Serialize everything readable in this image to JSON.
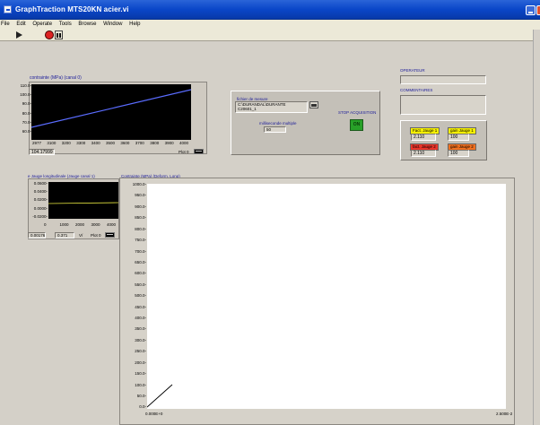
{
  "window": {
    "title": "GraphTraction MTS20KN acier.vi"
  },
  "menu": [
    "File",
    "Edit",
    "Operate",
    "Tools",
    "Browse",
    "Window",
    "Help"
  ],
  "top_chart": {
    "label": "contrainte (MPa) (canal 0)",
    "y_ticks": [
      "110.0-",
      "100.0-",
      "90.0-",
      "80.0-",
      "70.0-",
      "60.0-"
    ],
    "x_ticks": [
      "2977",
      "3100",
      "3200",
      "3300",
      "3400",
      "3500",
      "3600",
      "3700",
      "3800",
      "3900",
      "4000"
    ],
    "readout": "104.17999",
    "plot_label": "Plot 0",
    "trace_color": "#5a6cff"
  },
  "measure": {
    "file_label": "fichier de mesure",
    "file_path_1": "C:\\DURANDAL\\DURANTE",
    "file_path_2": "C20601_1",
    "ms_label": "milliseconde multiple",
    "ms_value": "50",
    "stop_label": "STOP ACQUISITION",
    "on_label": "ON"
  },
  "operator": {
    "label": "OPERATEUR",
    "comments_label": "COMMENTAIRES"
  },
  "gauges": {
    "g1_fact_label": "Fact. Jauge 1",
    "g1_fact_value": "2.110",
    "g1_gain_label": "gain Jauge 1",
    "g1_gain_value": "100",
    "g2_fact_label": "fact. Jauge 2",
    "g2_fact_value": "2.110",
    "g2_gain_label": "gain Jauge 2",
    "g2_gain_value": "100"
  },
  "small_chart": {
    "label": "e Jauge longitudinale (Jauge canal 1)",
    "y_ticks": [
      "0.0600-",
      "0.0400-",
      "0.0200-",
      "0.0000-",
      "-0.0200-"
    ],
    "x_ticks": [
      "0",
      "1000",
      "2000",
      "3000",
      "4000"
    ],
    "readout_1": "0.00176",
    "readout_2": "0.371",
    "unit": "V/",
    "plot_label": "Plot 0"
  },
  "big_chart": {
    "label": "Contrainte (MPa) (Deform. Long)",
    "y_ticks": [
      "1000.0-",
      "950.0-",
      "900.0-",
      "850.0-",
      "800.0-",
      "750.0-",
      "700.0-",
      "650.0-",
      "600.0-",
      "550.0-",
      "500.0-",
      "450.0-",
      "400.0-",
      "350.0-",
      "300.0-",
      "250.0-",
      "200.0-",
      "150.0-",
      "100.0-",
      "50.0-",
      "0.0-"
    ],
    "x_start": "0.000E+0",
    "x_end": "2.500E-2"
  }
}
